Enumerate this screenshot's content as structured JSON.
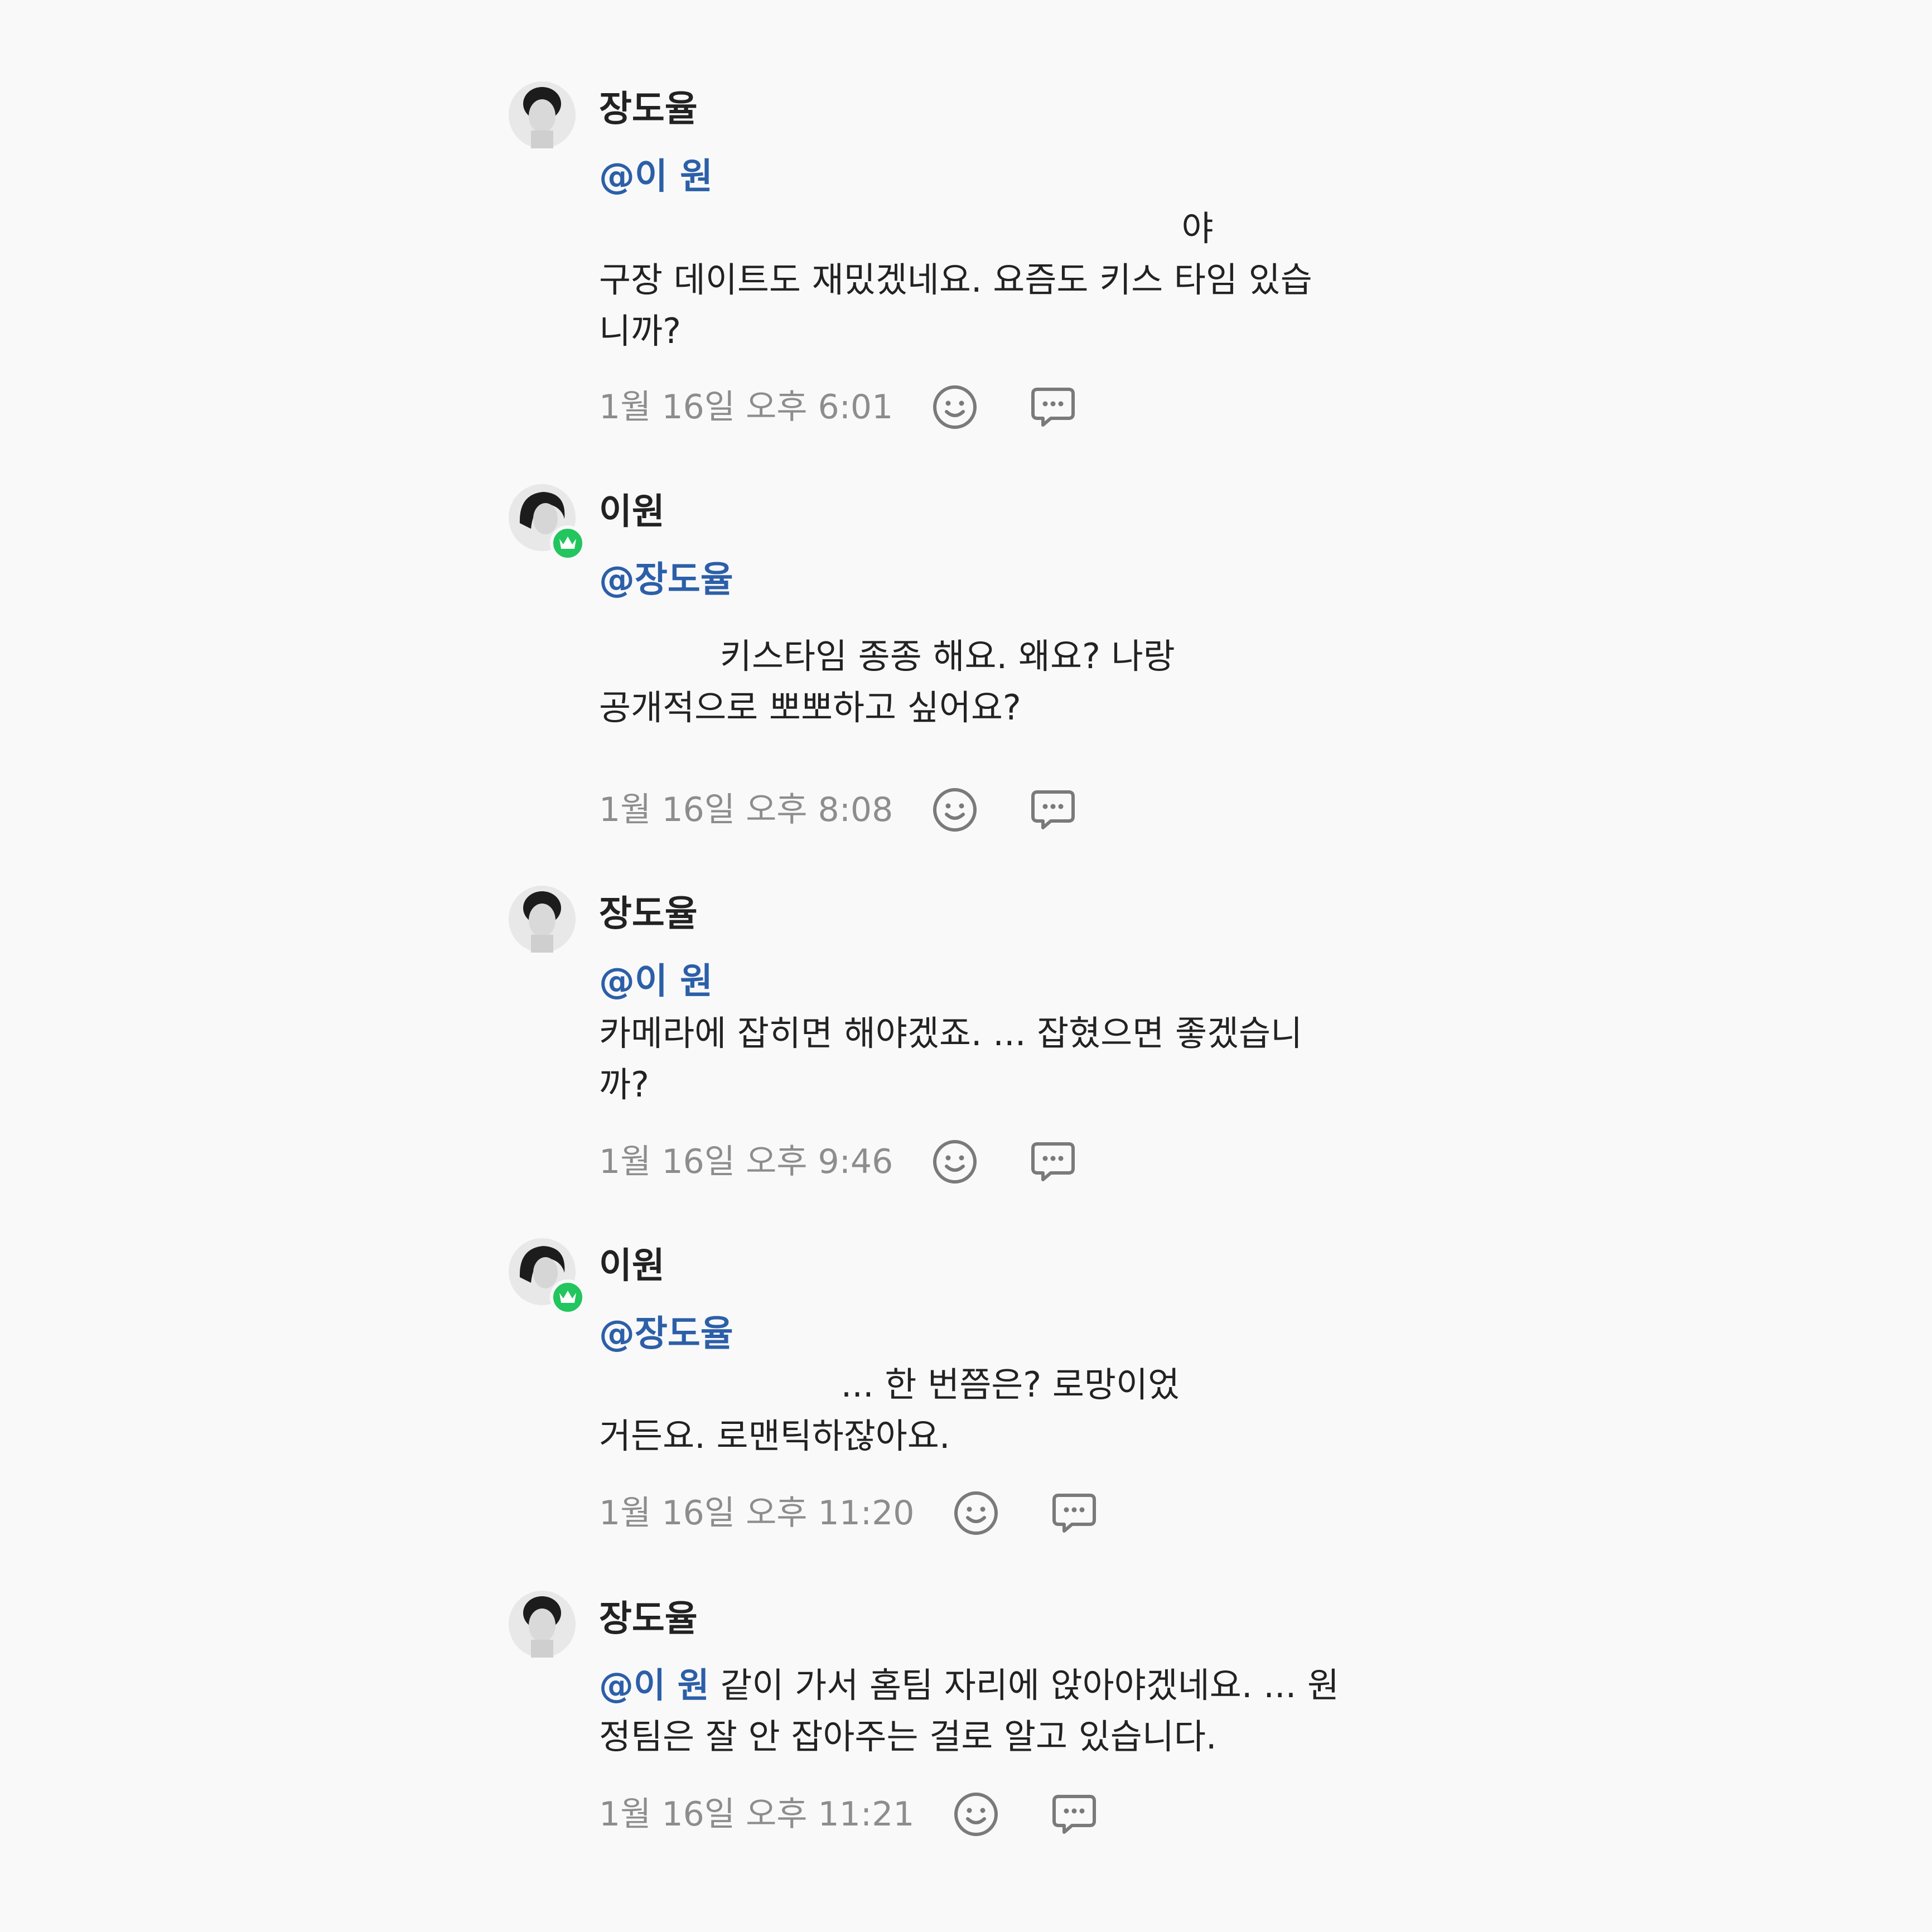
{
  "comments": [
    {
      "author": "장도율",
      "mention": "@이 원",
      "lines": [
        "                                                     야",
        "구장 데이트도 재밌겠네요. 요즘도 키스 타임 있습",
        "니까?"
      ],
      "time": "1월 16일 오후 6:01",
      "owner_badge": false
    },
    {
      "author": "이원",
      "mention": "@장도율",
      "lines": [
        "",
        "           키스타임 종종 해요. 왜요? 나랑",
        "공개적으로 뽀뽀하고 싶어요?"
      ],
      "time": "1월 16일 오후 8:08",
      "owner_badge": true
    },
    {
      "author": "장도율",
      "mention": "@이 원",
      "lines": [
        "카메라에 잡히면 해야겠죠. ... 잡혔으면 좋겠습니",
        "까?"
      ],
      "time": "1월 16일 오후 9:46",
      "owner_badge": false
    },
    {
      "author": "이원",
      "mention": "@장도율",
      "lines": [
        "                      ... 한 번쯤은? 로망이었",
        "거든요. 로맨틱하잖아요."
      ],
      "time": "1월 16일 오후 11:20",
      "owner_badge": true
    },
    {
      "author": "장도율",
      "mention": "@이 원",
      "lines": [
        " 같이 가서 홈팀 자리에 앉아야겠네요. ... 원",
        "정팀은 잘 안 잡아주는 걸로 알고 있습니다."
      ],
      "time": "1월 16일 오후 11:21",
      "owner_badge": false
    }
  ],
  "icons": {
    "reaction": "smiley-icon",
    "reply": "speech-bubble-icon",
    "badge": "crown-icon"
  },
  "colors": {
    "mention": "#2c5fa8",
    "badge": "#22c55e",
    "timestamp": "#8d8d8d",
    "background": "#f9f9fa"
  }
}
